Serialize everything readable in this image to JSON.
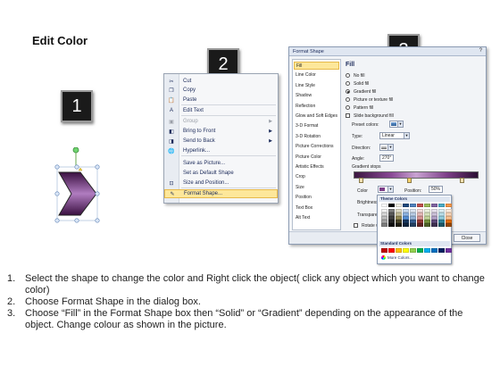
{
  "slide": {
    "title": "Edit Color",
    "badges": [
      "1",
      "2",
      "3"
    ]
  },
  "context_menu": {
    "items": [
      {
        "label": "Cut",
        "icon": "scissors-icon",
        "disabled": false,
        "arrow": false,
        "highlighted": false
      },
      {
        "label": "Copy",
        "icon": "copy-icon",
        "disabled": false,
        "arrow": false,
        "highlighted": false
      },
      {
        "label": "Paste",
        "icon": "paste-icon",
        "disabled": false,
        "arrow": false,
        "highlighted": false
      },
      {
        "label": "Edit Text",
        "icon": "edit-text-icon",
        "disabled": false,
        "arrow": false,
        "highlighted": false
      },
      {
        "label": "Group",
        "icon": "group-icon",
        "disabled": true,
        "arrow": true,
        "highlighted": false
      },
      {
        "label": "Bring to Front",
        "icon": "bring-front-icon",
        "disabled": false,
        "arrow": true,
        "highlighted": false
      },
      {
        "label": "Send to Back",
        "icon": "send-back-icon",
        "disabled": false,
        "arrow": true,
        "highlighted": false
      },
      {
        "label": "Hyperlink...",
        "icon": "hyperlink-icon",
        "disabled": false,
        "arrow": false,
        "highlighted": false
      },
      {
        "label": "Save as Picture...",
        "icon": "",
        "disabled": false,
        "arrow": false,
        "highlighted": false
      },
      {
        "label": "Set as Default Shape",
        "icon": "",
        "disabled": false,
        "arrow": false,
        "highlighted": false
      },
      {
        "label": "Size and Position...",
        "icon": "size-position-icon",
        "disabled": false,
        "arrow": false,
        "highlighted": false
      },
      {
        "label": "Format Shape...",
        "icon": "format-shape-icon",
        "disabled": false,
        "arrow": false,
        "highlighted": true
      }
    ]
  },
  "format_dialog": {
    "title": "Format Shape",
    "close_glyph": "?",
    "nav": [
      "Fill",
      "Line Color",
      "Line Style",
      "Shadow",
      "Reflection",
      "Glow and Soft Edges",
      "3-D Format",
      "3-D Rotation",
      "Picture Corrections",
      "Picture Color",
      "Artistic Effects",
      "Crop",
      "Size",
      "Position",
      "Text Box",
      "Alt Text"
    ],
    "selected_nav": "Fill",
    "pane_heading": "Fill",
    "fill_options": [
      {
        "label": "No fill",
        "selected": false
      },
      {
        "label": "Solid fill",
        "selected": false
      },
      {
        "label": "Gradient fill",
        "selected": true
      },
      {
        "label": "Picture or texture fill",
        "selected": false
      },
      {
        "label": "Pattern fill",
        "selected": false
      }
    ],
    "slide_background_label": "Slide background fill",
    "preset_colors_label": "Preset colors:",
    "type_label": "Type:",
    "type_value": "Linear",
    "direction_label": "Direction:",
    "angle_label": "Angle:",
    "angle_value": "270°",
    "gradient_stops_label": "Gradient stops",
    "color_label": "Color",
    "position_label": "Position:",
    "position_value": "50%",
    "brightness_label": "Brightness",
    "transparency_label": "Transparen",
    "rotate_label": "Rotate w",
    "close_button": "Close"
  },
  "color_popup": {
    "theme_heading": "Theme Colors",
    "standard_heading": "Standard Colors",
    "more_colors": "More Colors...",
    "theme_top": [
      "#ffffff",
      "#000000",
      "#eeece1",
      "#1f497d",
      "#4f81bd",
      "#c0504d",
      "#9bbb59",
      "#8064a2",
      "#4bacc6",
      "#f79646"
    ],
    "theme_shades": [
      [
        "#f2f2f2",
        "#7f7f7f",
        "#ddd9c3",
        "#c6d9f0",
        "#dbe5f1",
        "#f2dcdb",
        "#ebf1dd",
        "#e5e0ec",
        "#dbeef3",
        "#fdeada"
      ],
      [
        "#d8d8d8",
        "#595959",
        "#c4bd97",
        "#8db3e2",
        "#b8cce4",
        "#e5b9b7",
        "#d7e3bc",
        "#ccc1d9",
        "#b7dde8",
        "#fbd5b5"
      ],
      [
        "#bfbfbf",
        "#3f3f3f",
        "#938953",
        "#548dd4",
        "#95b3d7",
        "#d99694",
        "#c3d69b",
        "#b2a2c7",
        "#92cddc",
        "#fac08f"
      ],
      [
        "#a5a5a5",
        "#262626",
        "#494429",
        "#17365d",
        "#366092",
        "#953734",
        "#76923c",
        "#5f497a",
        "#31859b",
        "#e36c09"
      ],
      [
        "#7f7f7f",
        "#0c0c0c",
        "#1d1b10",
        "#0f243e",
        "#244061",
        "#632423",
        "#4f6128",
        "#3f3151",
        "#205867",
        "#974806"
      ]
    ],
    "standard": [
      "#c00000",
      "#ff0000",
      "#ffc000",
      "#ffff00",
      "#92d050",
      "#00b050",
      "#00b0f0",
      "#0070c0",
      "#002060",
      "#7030a0"
    ]
  },
  "instructions": [
    {
      "num": "1.",
      "text": "Select the shape to change the color and Right click the object( click any object which you want to change color)"
    },
    {
      "num": "2.",
      "text": "Choose Format Shape in the dialog box."
    },
    {
      "num": "3.",
      "text": "Choose “Fill” in the Format Shape box then “Solid” or “Gradient” depending on the appearance of the object. Change colour as shown in the picture."
    }
  ],
  "colors": {
    "shape_fill_dark": "#3a1040",
    "shape_fill_light": "#b07cc0",
    "highlight": "#fde79a"
  }
}
